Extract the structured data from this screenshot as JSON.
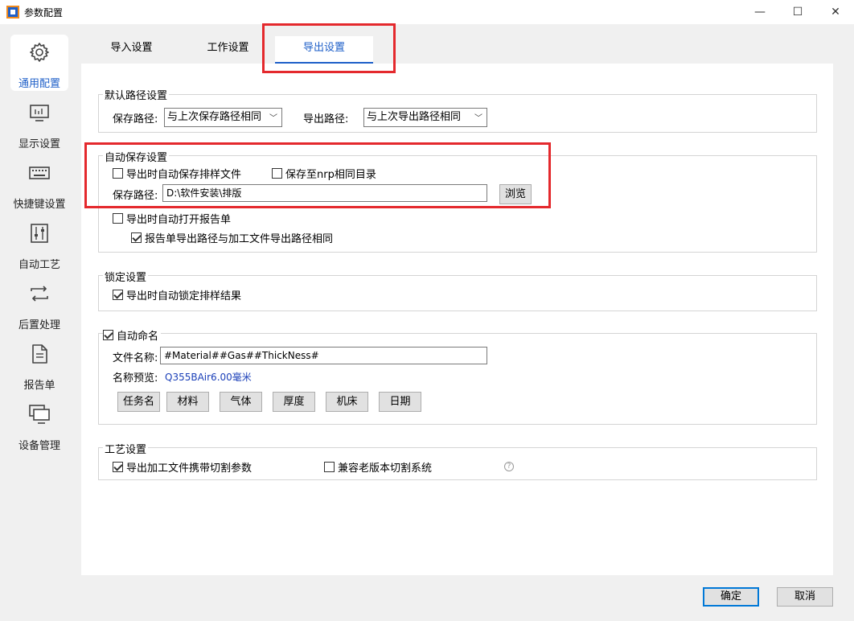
{
  "window": {
    "title": "参数配置",
    "minimize": "—",
    "maximize": "☐",
    "close": "✕"
  },
  "sidebar": {
    "items": [
      {
        "label": "通用配置",
        "icon": "gear-icon",
        "active": true
      },
      {
        "label": "显示设置",
        "icon": "monitor-icon"
      },
      {
        "label": "快捷键设置",
        "icon": "keyboard-icon"
      },
      {
        "label": "自动工艺",
        "icon": "sliders-icon"
      },
      {
        "label": "后置处理",
        "icon": "repeat-icon"
      },
      {
        "label": "报告单",
        "icon": "document-icon"
      },
      {
        "label": "设备管理",
        "icon": "devices-icon"
      }
    ]
  },
  "tabs": [
    {
      "label": "导入设置"
    },
    {
      "label": "工作设置"
    },
    {
      "label": "导出设置",
      "active": true
    }
  ],
  "default_path": {
    "title": "默认路径设置",
    "save_label": "保存路径:",
    "save_value": "与上次保存路径相同",
    "export_label": "导出路径:",
    "export_value": "与上次导出路径相同"
  },
  "auto_save": {
    "title": "自动保存设置",
    "auto_save_on_export": {
      "label": "导出时自动保存排样文件",
      "checked": false
    },
    "save_to_nrp_dir": {
      "label": "保存至nrp相同目录",
      "checked": false
    },
    "path_label": "保存路径:",
    "path_value": "D:\\软件安装\\排版",
    "browse": "浏览",
    "auto_open_report": {
      "label": "导出时自动打开报告单",
      "checked": false
    },
    "report_same_path": {
      "label": "报告单导出路径与加工文件导出路径相同",
      "checked": true
    }
  },
  "lock": {
    "title": "锁定设置",
    "auto_lock": {
      "label": "导出时自动锁定排样结果",
      "checked": true
    }
  },
  "auto_name": {
    "title": "自动命名",
    "checked": true,
    "filename_label": "文件名称:",
    "filename_value": "#Material##Gas##ThickNess#",
    "preview_label": "名称预览:",
    "preview_value": "Q355BAir6.00毫米",
    "buttons": [
      "任务名",
      "材料",
      "气体",
      "厚度",
      "机床",
      "日期"
    ]
  },
  "process": {
    "title": "工艺设置",
    "carry_cut_params": {
      "label": "导出加工文件携带切割参数",
      "checked": true
    },
    "compat_old": {
      "label": "兼容老版本切割系统",
      "checked": false
    },
    "help": "?"
  },
  "footer": {
    "ok": "确定",
    "cancel": "取消"
  },
  "colors": {
    "accent": "#1e5fc8",
    "highlight": "#e4292d"
  }
}
